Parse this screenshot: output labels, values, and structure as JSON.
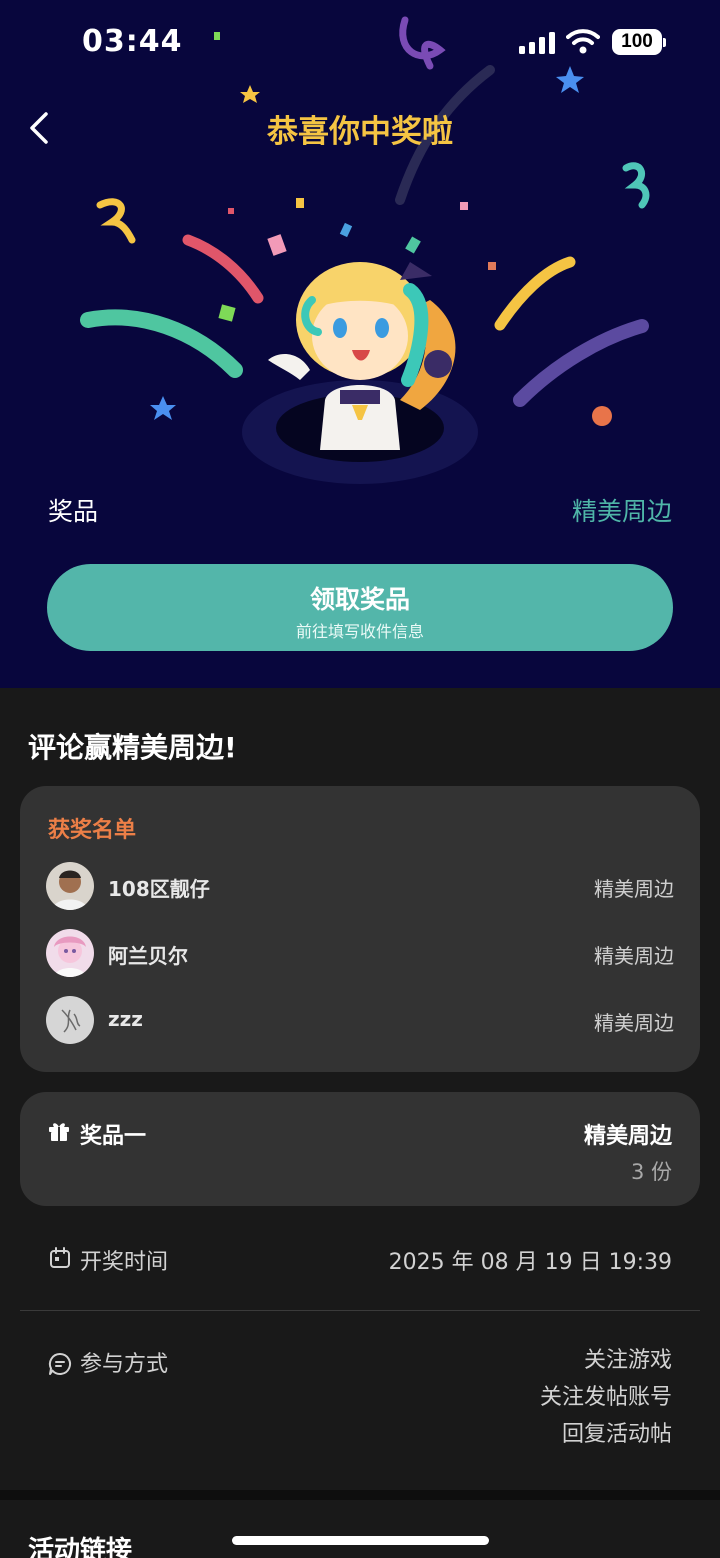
{
  "status_bar": {
    "time": "03:44",
    "battery": "100"
  },
  "header": {
    "title": "恭喜你中奖啦"
  },
  "prize": {
    "label": "奖品",
    "value": "精美周边"
  },
  "claim_button": {
    "title": "领取奖品",
    "subtitle": "前往填写收件信息"
  },
  "section": {
    "title": "评论赢精美周边!"
  },
  "winners": {
    "title": "获奖名单",
    "items": [
      {
        "name": "108区靓仔",
        "prize": "精美周边"
      },
      {
        "name": "阿兰贝尔",
        "prize": "精美周边"
      },
      {
        "name": "zzz",
        "prize": "精美周边"
      }
    ]
  },
  "prize_card": {
    "label": "奖品一",
    "value": "精美周边",
    "count": "3 份"
  },
  "draw_time": {
    "label": "开奖时间",
    "value": "2025 年 08 月 19 日 19:39"
  },
  "participation": {
    "label": "参与方式",
    "methods": [
      "关注游戏",
      "关注发帖账号",
      "回复活动帖"
    ]
  },
  "activity_link": {
    "title": "活动链接"
  },
  "colors": {
    "hero_bg": "#08063d",
    "title_gold": "#f5c443",
    "accent_teal": "#53b6aa",
    "winners_orange": "#ec7f47",
    "page_bg": "#191919",
    "card_bg": "#333333"
  }
}
